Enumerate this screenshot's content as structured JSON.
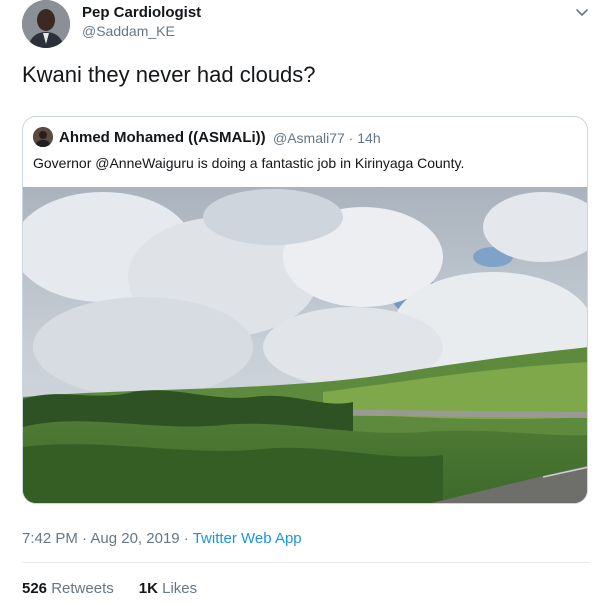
{
  "author": {
    "name": "Pep Cardiologist",
    "handle": "@Saddam_KE"
  },
  "tweet": {
    "text": "Kwani they never had clouds?"
  },
  "quoted_tweet": {
    "name": "Ahmed Mohamed ((ASMALi))",
    "handle": "@Asmali77",
    "separator": " · ",
    "age": "14h",
    "text": "Governor @AnneWaiguru is doing a fantastic job in Kirinyaga County."
  },
  "meta": {
    "time": "7:42 PM",
    "dot1": " · ",
    "date": "Aug 20, 2019",
    "dot2": " · ",
    "source": "Twitter Web App"
  },
  "stats": {
    "retweets_count": "526",
    "retweets_label": "Retweets",
    "likes_count": "1K",
    "likes_label": "Likes"
  },
  "icons": {
    "caret": "chevron-down-icon"
  },
  "colors": {
    "link": "#1b95e0",
    "secondary_text": "#657786",
    "border": "#ccd6dd"
  }
}
